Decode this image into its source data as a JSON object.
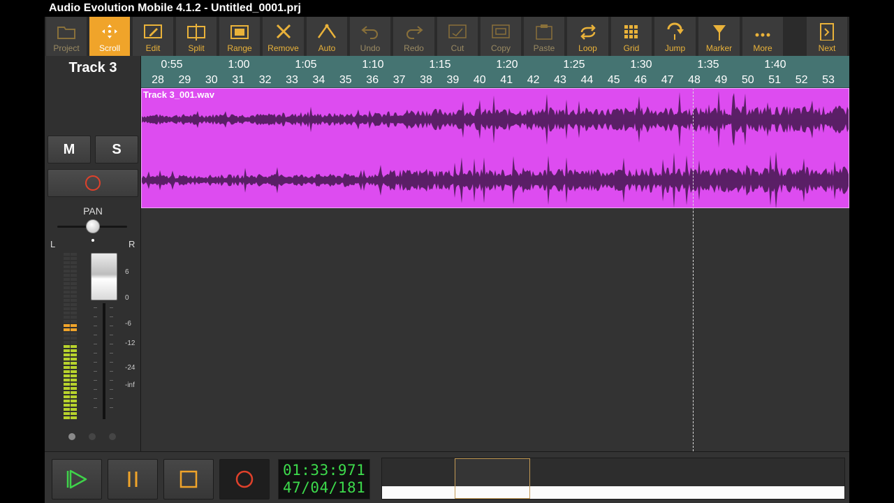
{
  "app_title": "Audio Evolution Mobile 4.1.2 - Untitled_0001.prj",
  "toolbar": [
    {
      "label": "Project",
      "icon": "folder-icon",
      "state": "dim"
    },
    {
      "label": "Scroll",
      "icon": "scroll-move-icon",
      "state": "active"
    },
    {
      "label": "Edit",
      "icon": "pencil-icon",
      "state": "normal"
    },
    {
      "label": "Split",
      "icon": "split-icon",
      "state": "normal"
    },
    {
      "label": "Range",
      "icon": "range-icon",
      "state": "normal"
    },
    {
      "label": "Remove",
      "icon": "close-x-icon",
      "state": "normal"
    },
    {
      "label": "Auto",
      "icon": "automation-icon",
      "state": "normal"
    },
    {
      "label": "Undo",
      "icon": "undo-icon",
      "state": "dim"
    },
    {
      "label": "Redo",
      "icon": "redo-icon",
      "state": "dim"
    },
    {
      "label": "Cut",
      "icon": "cut-icon",
      "state": "dim"
    },
    {
      "label": "Copy",
      "icon": "copy-icon",
      "state": "dim"
    },
    {
      "label": "Paste",
      "icon": "paste-icon",
      "state": "dim"
    },
    {
      "label": "Loop",
      "icon": "loop-icon",
      "state": "normal"
    },
    {
      "label": "Grid",
      "icon": "grid-icon",
      "state": "normal"
    },
    {
      "label": "Jump",
      "icon": "jump-icon",
      "state": "normal"
    },
    {
      "label": "Marker",
      "icon": "marker-icon",
      "state": "normal"
    },
    {
      "label": "More",
      "icon": "more-dots-icon",
      "state": "normal"
    },
    {
      "label": "Next",
      "icon": "next-page-icon",
      "state": "normal"
    }
  ],
  "track": {
    "name": "Track 3",
    "mute_label": "M",
    "solo_label": "S",
    "pan_label": "PAN",
    "pan_left": "L",
    "pan_right": "R",
    "pan_value": 0,
    "volume_scale": [
      "6",
      "0",
      "-6",
      "-12",
      "-24",
      "-inf"
    ]
  },
  "ruler": {
    "times": [
      "0:55",
      "1:00",
      "1:05",
      "1:10",
      "1:15",
      "1:20",
      "1:25",
      "1:30",
      "1:35",
      "1:40"
    ],
    "bars": [
      "28",
      "29",
      "30",
      "31",
      "32",
      "33",
      "34",
      "35",
      "36",
      "37",
      "38",
      "39",
      "40",
      "41",
      "42",
      "43",
      "44",
      "45",
      "46",
      "47",
      "48",
      "49",
      "50",
      "51",
      "52",
      "53"
    ]
  },
  "clip": {
    "name": "Track 3_001.wav"
  },
  "transport": {
    "time": "01:33:971",
    "bars_beats": "47/04/181"
  },
  "colors": {
    "accent": "#f0a42a",
    "clip": "#dd4cf0",
    "waveform": "#5a1f66",
    "ruler": "#457472",
    "clock_text": "#3ddb4c"
  }
}
